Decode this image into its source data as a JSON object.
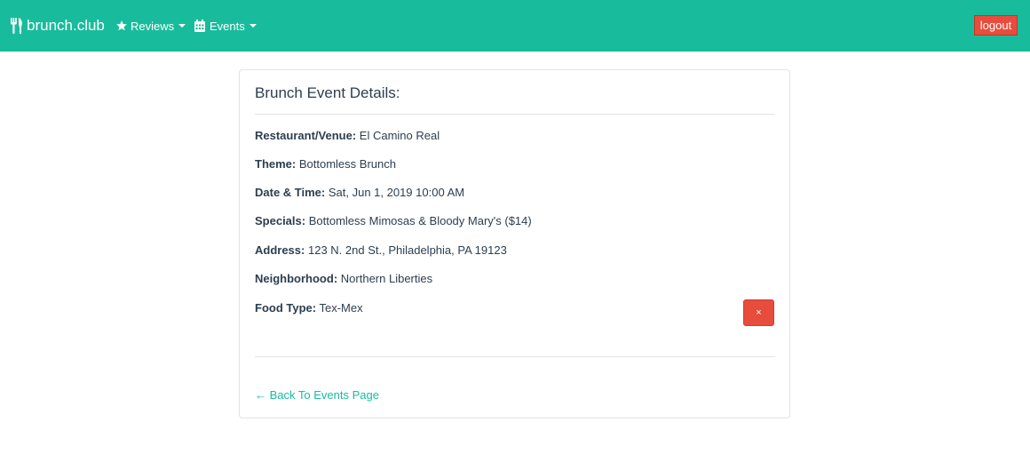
{
  "navbar": {
    "brand": "brunch.club",
    "brand_icon": "utensils-icon",
    "items": [
      {
        "label": "Reviews",
        "icon": "star-icon"
      },
      {
        "label": "Events",
        "icon": "calendar-icon"
      }
    ],
    "logout_label": "logout",
    "colors": {
      "background": "#18bc9c",
      "logout": "#e74c3c"
    }
  },
  "event": {
    "title": "Brunch Event Details:",
    "fields": [
      {
        "label": "Restaurant/Venue:",
        "value": "El Camino Real"
      },
      {
        "label": "Theme:",
        "value": "Bottomless Brunch"
      },
      {
        "label": "Date & Time:",
        "value": "Sat, Jun 1, 2019 10:00 AM"
      },
      {
        "label": "Specials:",
        "value": "Bottomless Mimosas & Bloody Mary's ($14)"
      },
      {
        "label": "Address:",
        "value": "123 N. 2nd St., Philadelphia, PA 19123"
      },
      {
        "label": "Neighborhood:",
        "value": "Northern Liberties"
      },
      {
        "label": "Food Type:",
        "value": "Tex-Mex"
      }
    ],
    "delete_label": "×",
    "back_link": "← Back To Events Page"
  }
}
